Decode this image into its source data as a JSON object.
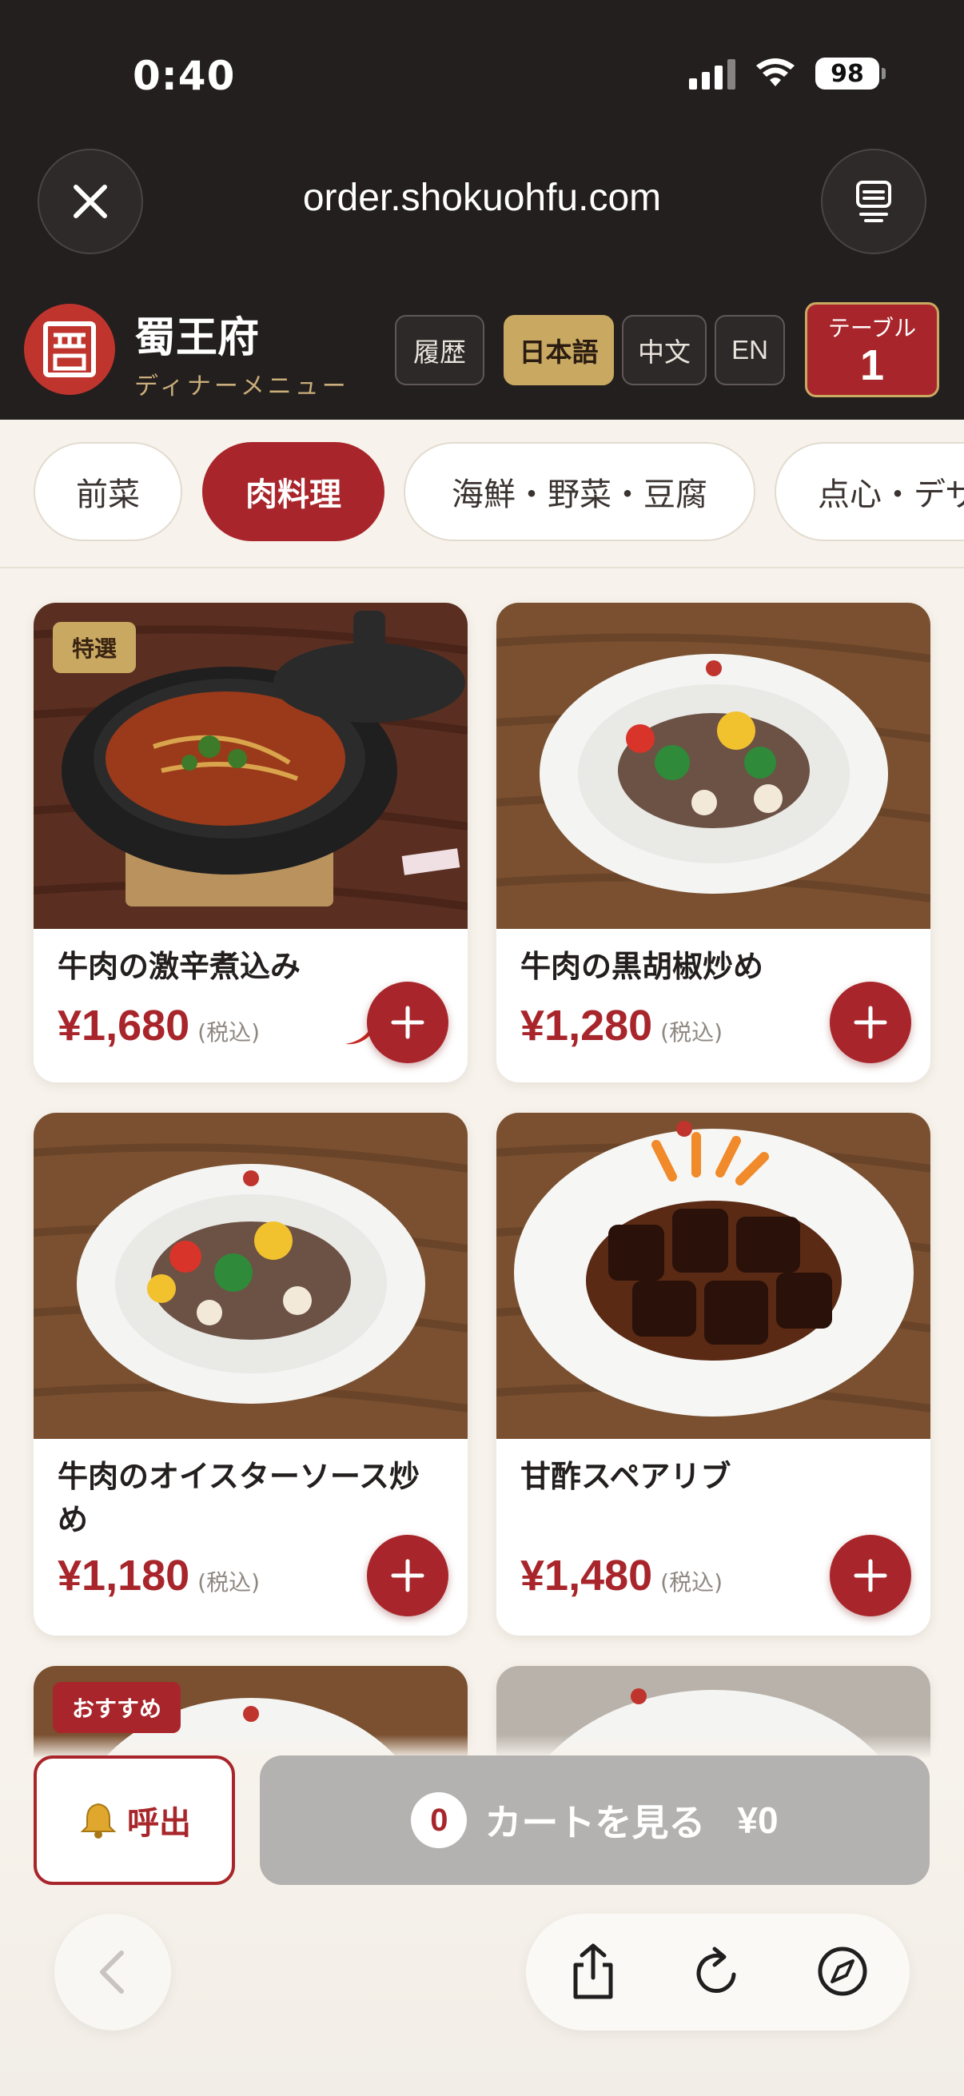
{
  "status_bar": {
    "time": "0:40",
    "battery": "98"
  },
  "browser": {
    "url": "order.shokuohfu.com"
  },
  "header": {
    "brand_name": "蜀王府",
    "brand_subtitle": "ディナーメニュー",
    "history_label": "履歴",
    "languages": [
      "日本語",
      "中文",
      "EN"
    ],
    "active_language": "日本語",
    "table_label": "テーブル",
    "table_number": "1"
  },
  "categories": [
    "前菜",
    "肉料理",
    "海鮮・野菜・豆腐",
    "点心・デザ"
  ],
  "active_category": "肉料理",
  "products": [
    {
      "title": "牛肉の激辛煮込み",
      "price": "¥1,680",
      "tax": "(税込)",
      "badge": "特選",
      "spicy": true
    },
    {
      "title": "牛肉の黒胡椒炒め",
      "price": "¥1,280",
      "tax": "(税込)"
    },
    {
      "title": "牛肉のオイスターソース炒め",
      "price": "¥1,180",
      "tax": "(税込)"
    },
    {
      "title": "甘酢スペアリブ",
      "price": "¥1,480",
      "tax": "(税込)"
    },
    {
      "badge": "おすすめ"
    },
    {}
  ],
  "bottom": {
    "call_label": "呼出",
    "cart_count": "0",
    "cart_label": "カートを見る",
    "cart_total": "¥0"
  },
  "colors": {
    "accent": "#a8262b",
    "gold": "#c9a862",
    "dark": "#231f1e"
  }
}
